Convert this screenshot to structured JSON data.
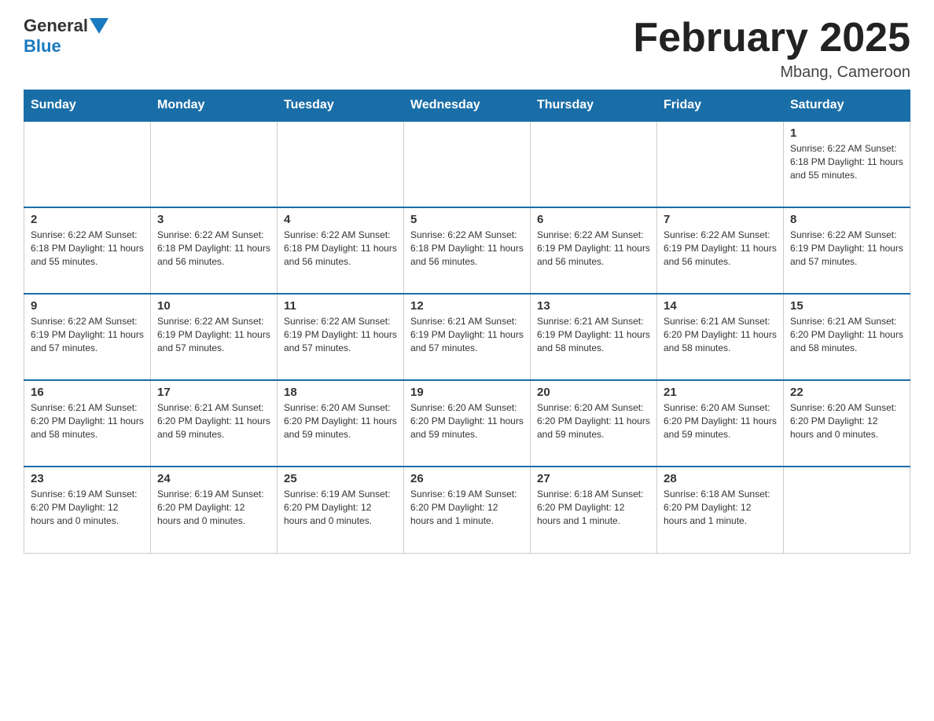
{
  "header": {
    "logo_general": "General",
    "logo_blue": "Blue",
    "month_title": "February 2025",
    "location": "Mbang, Cameroon"
  },
  "days_of_week": [
    "Sunday",
    "Monday",
    "Tuesday",
    "Wednesday",
    "Thursday",
    "Friday",
    "Saturday"
  ],
  "weeks": [
    [
      {
        "day": "",
        "info": ""
      },
      {
        "day": "",
        "info": ""
      },
      {
        "day": "",
        "info": ""
      },
      {
        "day": "",
        "info": ""
      },
      {
        "day": "",
        "info": ""
      },
      {
        "day": "",
        "info": ""
      },
      {
        "day": "1",
        "info": "Sunrise: 6:22 AM\nSunset: 6:18 PM\nDaylight: 11 hours\nand 55 minutes."
      }
    ],
    [
      {
        "day": "2",
        "info": "Sunrise: 6:22 AM\nSunset: 6:18 PM\nDaylight: 11 hours\nand 55 minutes."
      },
      {
        "day": "3",
        "info": "Sunrise: 6:22 AM\nSunset: 6:18 PM\nDaylight: 11 hours\nand 56 minutes."
      },
      {
        "day": "4",
        "info": "Sunrise: 6:22 AM\nSunset: 6:18 PM\nDaylight: 11 hours\nand 56 minutes."
      },
      {
        "day": "5",
        "info": "Sunrise: 6:22 AM\nSunset: 6:18 PM\nDaylight: 11 hours\nand 56 minutes."
      },
      {
        "day": "6",
        "info": "Sunrise: 6:22 AM\nSunset: 6:19 PM\nDaylight: 11 hours\nand 56 minutes."
      },
      {
        "day": "7",
        "info": "Sunrise: 6:22 AM\nSunset: 6:19 PM\nDaylight: 11 hours\nand 56 minutes."
      },
      {
        "day": "8",
        "info": "Sunrise: 6:22 AM\nSunset: 6:19 PM\nDaylight: 11 hours\nand 57 minutes."
      }
    ],
    [
      {
        "day": "9",
        "info": "Sunrise: 6:22 AM\nSunset: 6:19 PM\nDaylight: 11 hours\nand 57 minutes."
      },
      {
        "day": "10",
        "info": "Sunrise: 6:22 AM\nSunset: 6:19 PM\nDaylight: 11 hours\nand 57 minutes."
      },
      {
        "day": "11",
        "info": "Sunrise: 6:22 AM\nSunset: 6:19 PM\nDaylight: 11 hours\nand 57 minutes."
      },
      {
        "day": "12",
        "info": "Sunrise: 6:21 AM\nSunset: 6:19 PM\nDaylight: 11 hours\nand 57 minutes."
      },
      {
        "day": "13",
        "info": "Sunrise: 6:21 AM\nSunset: 6:19 PM\nDaylight: 11 hours\nand 58 minutes."
      },
      {
        "day": "14",
        "info": "Sunrise: 6:21 AM\nSunset: 6:20 PM\nDaylight: 11 hours\nand 58 minutes."
      },
      {
        "day": "15",
        "info": "Sunrise: 6:21 AM\nSunset: 6:20 PM\nDaylight: 11 hours\nand 58 minutes."
      }
    ],
    [
      {
        "day": "16",
        "info": "Sunrise: 6:21 AM\nSunset: 6:20 PM\nDaylight: 11 hours\nand 58 minutes."
      },
      {
        "day": "17",
        "info": "Sunrise: 6:21 AM\nSunset: 6:20 PM\nDaylight: 11 hours\nand 59 minutes."
      },
      {
        "day": "18",
        "info": "Sunrise: 6:20 AM\nSunset: 6:20 PM\nDaylight: 11 hours\nand 59 minutes."
      },
      {
        "day": "19",
        "info": "Sunrise: 6:20 AM\nSunset: 6:20 PM\nDaylight: 11 hours\nand 59 minutes."
      },
      {
        "day": "20",
        "info": "Sunrise: 6:20 AM\nSunset: 6:20 PM\nDaylight: 11 hours\nand 59 minutes."
      },
      {
        "day": "21",
        "info": "Sunrise: 6:20 AM\nSunset: 6:20 PM\nDaylight: 11 hours\nand 59 minutes."
      },
      {
        "day": "22",
        "info": "Sunrise: 6:20 AM\nSunset: 6:20 PM\nDaylight: 12 hours\nand 0 minutes."
      }
    ],
    [
      {
        "day": "23",
        "info": "Sunrise: 6:19 AM\nSunset: 6:20 PM\nDaylight: 12 hours\nand 0 minutes."
      },
      {
        "day": "24",
        "info": "Sunrise: 6:19 AM\nSunset: 6:20 PM\nDaylight: 12 hours\nand 0 minutes."
      },
      {
        "day": "25",
        "info": "Sunrise: 6:19 AM\nSunset: 6:20 PM\nDaylight: 12 hours\nand 0 minutes."
      },
      {
        "day": "26",
        "info": "Sunrise: 6:19 AM\nSunset: 6:20 PM\nDaylight: 12 hours\nand 1 minute."
      },
      {
        "day": "27",
        "info": "Sunrise: 6:18 AM\nSunset: 6:20 PM\nDaylight: 12 hours\nand 1 minute."
      },
      {
        "day": "28",
        "info": "Sunrise: 6:18 AM\nSunset: 6:20 PM\nDaylight: 12 hours\nand 1 minute."
      },
      {
        "day": "",
        "info": ""
      }
    ]
  ]
}
